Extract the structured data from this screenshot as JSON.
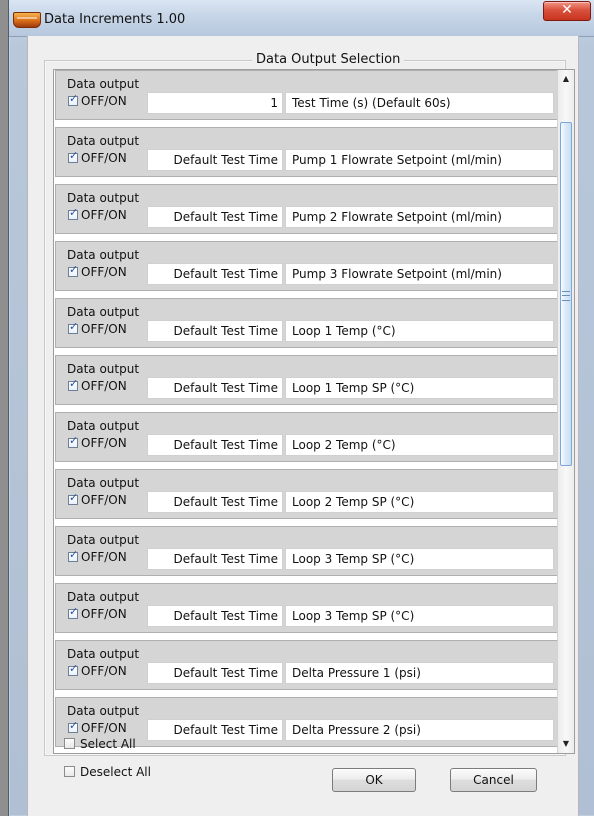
{
  "window": {
    "title": "Data Increments  1.00",
    "close_icon": "close-icon",
    "logo_icon": "app-logo-icon"
  },
  "group": {
    "legend": "Data Output Selection"
  },
  "rows": [
    {
      "title": "Data output",
      "toggle_label": "OFF/ON",
      "checked": true,
      "value": "1",
      "description": "Test Time (s) (Default 60s)"
    },
    {
      "title": "Data output",
      "toggle_label": "OFF/ON",
      "checked": true,
      "value": "Default Test Time",
      "description": "Pump 1 Flowrate Setpoint (ml/min)"
    },
    {
      "title": "Data output",
      "toggle_label": "OFF/ON",
      "checked": true,
      "value": "Default Test Time",
      "description": "Pump 2 Flowrate Setpoint (ml/min)"
    },
    {
      "title": "Data output",
      "toggle_label": "OFF/ON",
      "checked": true,
      "value": "Default Test Time",
      "description": "Pump 3 Flowrate Setpoint (ml/min)"
    },
    {
      "title": "Data output",
      "toggle_label": "OFF/ON",
      "checked": true,
      "value": "Default Test Time",
      "description": "Loop 1 Temp (°C)"
    },
    {
      "title": "Data output",
      "toggle_label": "OFF/ON",
      "checked": true,
      "value": "Default Test Time",
      "description": "Loop 1 Temp SP (°C)"
    },
    {
      "title": "Data output",
      "toggle_label": "OFF/ON",
      "checked": true,
      "value": "Default Test Time",
      "description": "Loop 2 Temp (°C)"
    },
    {
      "title": "Data output",
      "toggle_label": "OFF/ON",
      "checked": true,
      "value": "Default Test Time",
      "description": "Loop 2 Temp SP (°C)"
    },
    {
      "title": "Data output",
      "toggle_label": "OFF/ON",
      "checked": true,
      "value": "Default Test Time",
      "description": "Loop 3 Temp SP (°C)"
    },
    {
      "title": "Data output",
      "toggle_label": "OFF/ON",
      "checked": true,
      "value": "Default Test Time",
      "description": "Loop 3 Temp SP (°C)"
    },
    {
      "title": "Data output",
      "toggle_label": "OFF/ON",
      "checked": true,
      "value": "Default Test Time",
      "description": "Delta Pressure 1 (psi)"
    },
    {
      "title": "Data output",
      "toggle_label": "OFF/ON",
      "checked": true,
      "value": "Default Test Time",
      "description": "Delta Pressure 2 (psi)"
    }
  ],
  "controls": {
    "select_all_label": "Select All",
    "deselect_all_label": "Deselect All",
    "ok_label": "OK",
    "cancel_label": "Cancel"
  },
  "scrollbar": {
    "up_icon": "chevron-up-icon",
    "down_icon": "chevron-down-icon",
    "grip_icon": "grip-icon"
  }
}
